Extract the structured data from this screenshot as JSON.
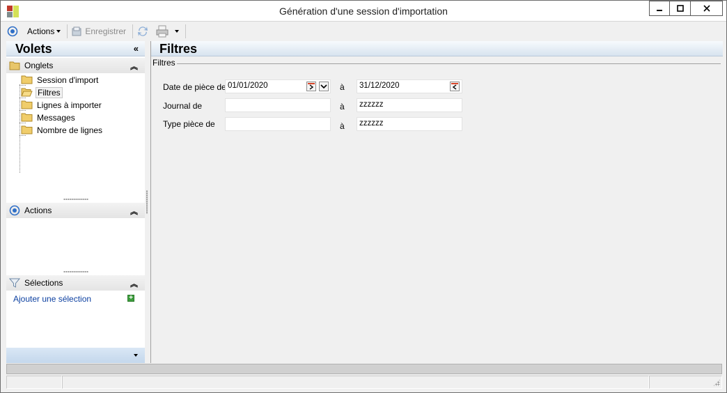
{
  "window": {
    "title": "Génération d'une session d'importation"
  },
  "toolbar": {
    "actions_label": "Actions",
    "save_label": "Enregistrer"
  },
  "left_panel": {
    "title": "Volets",
    "onglets": {
      "title": "Onglets",
      "items": [
        {
          "label": "Session d'import"
        },
        {
          "label": "Filtres"
        },
        {
          "label": "Lignes à importer"
        },
        {
          "label": "Messages"
        },
        {
          "label": "Nombre de lignes"
        }
      ]
    },
    "actions": {
      "title": "Actions"
    },
    "selections": {
      "title": "Sélections",
      "add_label": "Ajouter une sélection"
    }
  },
  "main": {
    "title": "Filtres",
    "group_label": "Filtres",
    "rows": [
      {
        "label": "Date de pièce de",
        "from": "01/01/2020",
        "to_label": "à",
        "to": "31/12/2020"
      },
      {
        "label": "Journal de",
        "from": "",
        "to_label": "à",
        "to": "zzzzzz"
      },
      {
        "label": "Type pièce de",
        "from": "",
        "to_label": "à",
        "to": "zzzzzz"
      }
    ]
  },
  "colors": {
    "header_gradient_top": "#f7fafd",
    "header_gradient_bottom": "#d7e3ef",
    "link": "#0b3fa0",
    "accent": "#2f6fc7"
  }
}
